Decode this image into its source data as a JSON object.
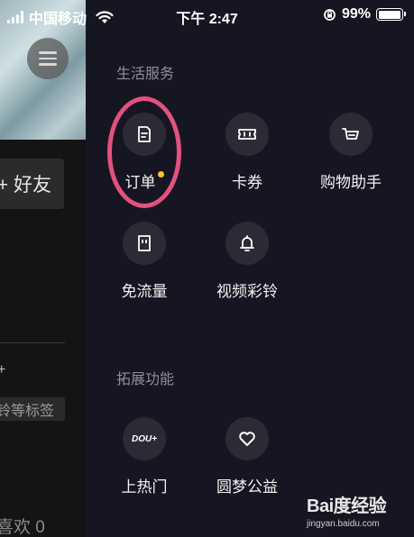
{
  "status_bar": {
    "carrier": "中国移动",
    "time": "下午 2:47",
    "battery": "99%",
    "battery_level": 0.99
  },
  "background_page": {
    "add_friend_label": "+ 好友",
    "tag_hint": "铃等标签",
    "likes_label": "喜欢 0"
  },
  "drawer": {
    "sections": [
      {
        "title": "生活服务",
        "items": [
          {
            "label": "订单",
            "icon": "document-icon",
            "badge": true
          },
          {
            "label": "卡券",
            "icon": "ticket-icon"
          },
          {
            "label": "购物助手",
            "icon": "cart-icon"
          },
          {
            "label": "免流量",
            "icon": "sim-card-icon"
          },
          {
            "label": "视频彩铃",
            "icon": "bell-icon"
          }
        ]
      },
      {
        "title": "拓展功能",
        "items": [
          {
            "label": "上热门",
            "icon": "dou-plus-icon",
            "icon_text": "DOU+"
          },
          {
            "label": "圆梦公益",
            "icon": "heart-icon"
          }
        ]
      }
    ]
  },
  "watermark": {
    "logo": "Bai度经验",
    "url": "jingyan.baidu.com"
  },
  "colors": {
    "drawer_bg": "#161622",
    "icon_bg": "#2b2b36",
    "badge": "#f6c629",
    "annotation": "#e2517f"
  }
}
